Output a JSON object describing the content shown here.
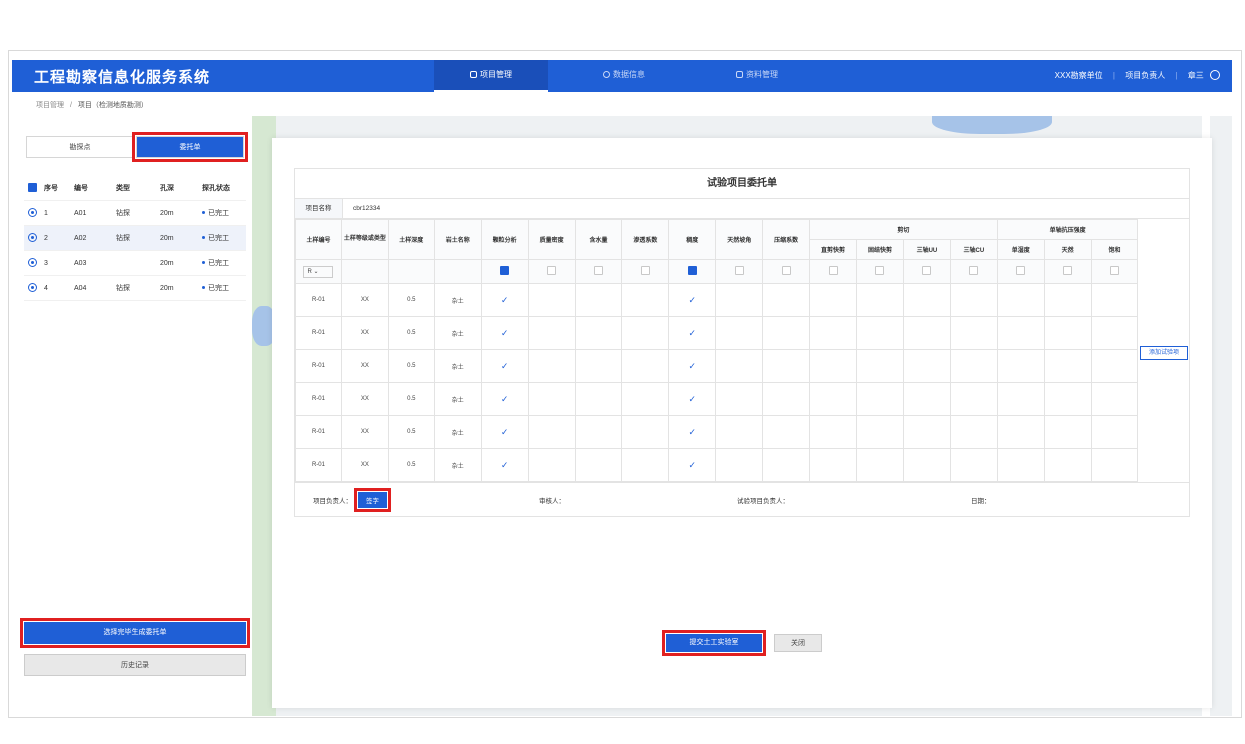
{
  "app": {
    "title": "工程勘察信息化服务系统"
  },
  "nav": [
    {
      "label": "项目管理",
      "active": true
    },
    {
      "label": "数据信息",
      "active": false
    },
    {
      "label": "资料管理",
      "active": false
    }
  ],
  "user": {
    "org": "XXX勘察单位",
    "role": "项目负责人",
    "name": "章三"
  },
  "breadcrumb": {
    "root": "项目管理",
    "sep": "/",
    "current": "项目（检测地质勘测）"
  },
  "left": {
    "tabs": [
      "勘探点",
      "委托单"
    ],
    "columns": [
      "序号",
      "编号",
      "类型",
      "孔深",
      "探孔状态"
    ],
    "rows": [
      {
        "no": "1",
        "code": "A01",
        "type": "钻探",
        "depth": "20m",
        "status": "已完工"
      },
      {
        "no": "2",
        "code": "A02",
        "type": "钻探",
        "depth": "20m",
        "status": "已完工"
      },
      {
        "no": "3",
        "code": "A03",
        "type": "",
        "depth": "20m",
        "status": "已完工"
      },
      {
        "no": "4",
        "code": "A04",
        "type": "钻探",
        "depth": "20m",
        "status": "已完工"
      }
    ],
    "generate_button": "选择完毕生成委托单",
    "history_button": "历史记录"
  },
  "dialog": {
    "title": "试验项目委托单",
    "project_label": "项目名称",
    "project_value": "cbr12334",
    "headers": {
      "sample_no": "土样编号",
      "sample_grade": "土样等级或类型",
      "sample_depth": "土样深度",
      "soil_name": "岩土名称",
      "particle": "颗粒分析",
      "density": "质量密度",
      "water": "含水量",
      "permeability": "渗透系数",
      "ratio": "稠度",
      "repose": "天然坡角",
      "compress": "压缩系数",
      "shear_group": "剪切",
      "shear_cols": [
        "直剪快剪",
        "固结快剪",
        "三轴UU",
        "三轴CU"
      ],
      "uc_group": "单轴抗压强度",
      "uc_cols": [
        "单湿度",
        "天然",
        "饱和"
      ]
    },
    "select_value": "R",
    "rows": [
      {
        "no": "R-01",
        "grade": "XX",
        "depth": "0.5",
        "name": "杂土"
      },
      {
        "no": "R-01",
        "grade": "XX",
        "depth": "0.5",
        "name": "杂土"
      },
      {
        "no": "R-01",
        "grade": "XX",
        "depth": "0.5",
        "name": "杂土"
      },
      {
        "no": "R-01",
        "grade": "XX",
        "depth": "0.5",
        "name": "杂土"
      },
      {
        "no": "R-01",
        "grade": "XX",
        "depth": "0.5",
        "name": "杂土"
      },
      {
        "no": "R-01",
        "grade": "XX",
        "depth": "0.5",
        "name": "杂土"
      }
    ],
    "tick": "✓",
    "footer": {
      "owner": "项目负责人：",
      "sign": "签字",
      "reviewer": "审核人：",
      "lab_owner": "试验项目负责人：",
      "date": "日期："
    },
    "add_button": "添加试验项",
    "submit_button": "提交土工实验室",
    "close_button": "关闭"
  },
  "colors": {
    "primary": "#1f5fd6",
    "highlight": "#e02020"
  }
}
